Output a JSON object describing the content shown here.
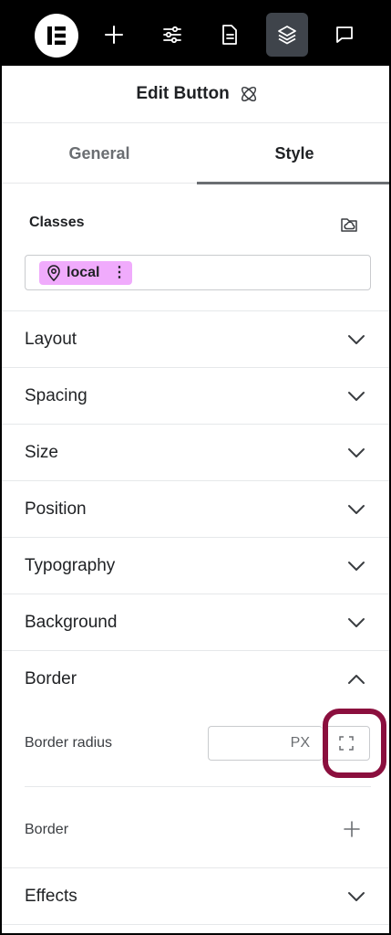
{
  "topbar": {
    "logo": "elementor-logo-icon",
    "buttons": [
      {
        "icon": "plus-icon",
        "active": false
      },
      {
        "icon": "sliders-icon",
        "active": false
      },
      {
        "icon": "page-icon",
        "active": false
      },
      {
        "icon": "layers-icon",
        "active": true
      },
      {
        "icon": "comment-icon",
        "active": false
      }
    ]
  },
  "header": {
    "title": "Edit Button",
    "icon": "atom-icon"
  },
  "tabs": [
    {
      "label": "General",
      "active": false
    },
    {
      "label": "Style",
      "active": true
    }
  ],
  "classes": {
    "label": "Classes",
    "chip": {
      "label": "local",
      "icon": "location-pin-icon",
      "color": "#f0abfc"
    }
  },
  "sections": {
    "layout": "Layout",
    "spacing": "Spacing",
    "size": "Size",
    "position": "Position",
    "typography": "Typography",
    "background": "Background",
    "border": "Border",
    "effects": "Effects"
  },
  "border": {
    "radius_label": "Border radius",
    "radius_value": "",
    "radius_unit": "PX",
    "border_label": "Border",
    "highlight_color": "#8b0f3e"
  }
}
